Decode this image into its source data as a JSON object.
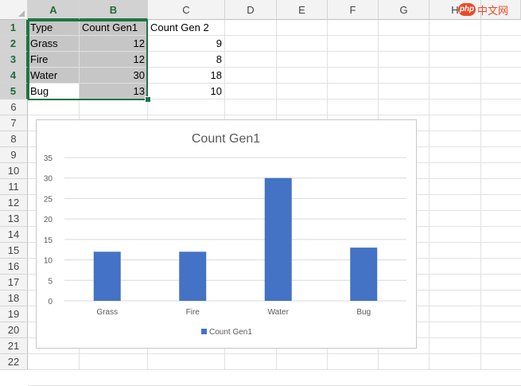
{
  "watermark": {
    "badge": "php",
    "text": "中文网"
  },
  "columns": [
    "A",
    "B",
    "C",
    "D",
    "E",
    "F",
    "G",
    "H"
  ],
  "selected_columns": [
    "A",
    "B"
  ],
  "rows": [
    "1",
    "2",
    "3",
    "4",
    "5",
    "6",
    "7",
    "8",
    "9",
    "10",
    "11",
    "12",
    "13",
    "14",
    "15",
    "16",
    "17",
    "18",
    "19",
    "20",
    "21",
    "22"
  ],
  "selected_rows": [
    "1",
    "2",
    "3",
    "4",
    "5"
  ],
  "table": {
    "headers": [
      "Type",
      "Count Gen1",
      "Count Gen 2"
    ],
    "rows": [
      [
        "Grass",
        "12",
        "9"
      ],
      [
        "Fire",
        "12",
        "8"
      ],
      [
        "Water",
        "30",
        "18"
      ],
      [
        "Bug",
        "13",
        "10"
      ]
    ]
  },
  "colors": {
    "accent": "#217346",
    "bar": "#4472c4",
    "selection_fill": "#c6c6c6"
  },
  "chart_data": {
    "type": "bar",
    "title": "Count Gen1",
    "categories": [
      "Grass",
      "Fire",
      "Water",
      "Bug"
    ],
    "series": [
      {
        "name": "Count Gen1",
        "values": [
          12,
          12,
          30,
          13
        ]
      }
    ],
    "ylim": [
      0,
      35
    ],
    "yticks": [
      0,
      5,
      10,
      15,
      20,
      25,
      30,
      35
    ],
    "grid": true,
    "legend": "bottom"
  }
}
